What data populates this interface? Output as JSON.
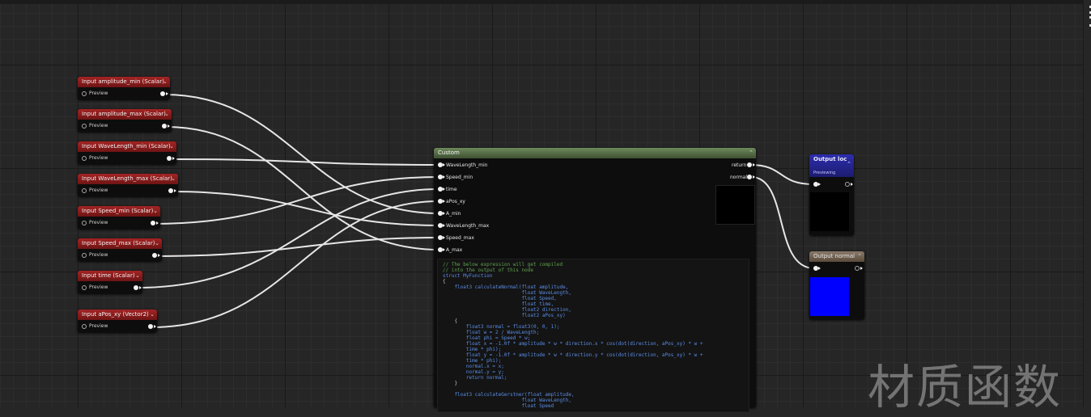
{
  "input_nodes": [
    {
      "title": "Input amplitude_min (Scalar)",
      "preview": "Preview"
    },
    {
      "title": "Input amplitude_max (Scalar)",
      "preview": "Preview"
    },
    {
      "title": "Input WaveLength_min (Scalar)",
      "preview": "Preview"
    },
    {
      "title": "Input WaveLength_max (Scalar)",
      "preview": "Preview"
    },
    {
      "title": "Input Speed_min (Scalar)",
      "preview": "Preview"
    },
    {
      "title": "Input Speed_max (Scalar)",
      "preview": "Preview"
    },
    {
      "title": "Input time (Scalar)",
      "preview": "Preview"
    },
    {
      "title": "Input aPos_xy (Vector2)",
      "preview": "Preview"
    }
  ],
  "custom_node": {
    "title": "Custom",
    "inputs": [
      "WaveLength_min",
      "Speed_min",
      "time",
      "aPos_xy",
      "A_min",
      "WaveLength_max",
      "Speed_max",
      "A_max"
    ],
    "outputs": [
      "return",
      "normal"
    ],
    "code_lines": [
      "// The below expression will get compiled",
      "// into the output of this node",
      "struct MyFunction",
      "{",
      "    float3 calculateNormal(float amplitude,",
      "                           float WaveLength,",
      "                           float Speed,",
      "                           float time,",
      "                           float2 direction,",
      "                           float2 aPos_xy)",
      "    {",
      "        float3 normal = float3(0, 0, 1);",
      "        float w = 2 / WaveLength;",
      "        float phi = Speed * w;",
      "        float x = -1.0f * amplitude * w * direction.x * cos(dot(direction, aPos_xy) * w +",
      "        time * phi);",
      "        float y = -1.0f * amplitude * w * direction.y * cos(dot(direction, aPos_xy) * w +",
      "        time * phi);",
      "        normal.x = x;",
      "        normal.y = y;",
      "        return normal;",
      "    }",
      "",
      "    float3 calculateGerstner(float amplitude,",
      "                           float WaveLength,",
      "                           float Speed"
    ]
  },
  "output_loc": {
    "title": "Output loc",
    "status": "Previewing",
    "preview_color": "#000000"
  },
  "output_normal": {
    "title": "Output normal",
    "preview_color": "#0000ff"
  },
  "watermark": "材质函数",
  "colors": {
    "input_header": "#a52424",
    "custom_header": "#6d8a5a",
    "output_loc_header": "#2a2a9a",
    "output_normal_header": "#7a6a5a",
    "wire": "#e8e8e8"
  }
}
